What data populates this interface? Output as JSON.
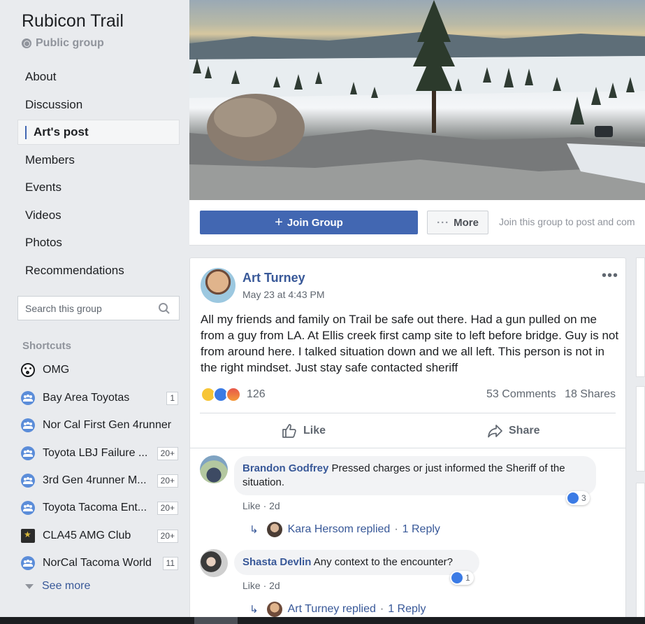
{
  "group": {
    "title": "Rubicon Trail",
    "privacy": "Public group"
  },
  "nav": {
    "items": [
      {
        "label": "About"
      },
      {
        "label": "Discussion"
      },
      {
        "label": "Art's post"
      },
      {
        "label": "Members"
      },
      {
        "label": "Events"
      },
      {
        "label": "Videos"
      },
      {
        "label": "Photos"
      },
      {
        "label": "Recommendations"
      }
    ],
    "active_index": 2
  },
  "search": {
    "placeholder": "Search this group"
  },
  "shortcuts": {
    "title": "Shortcuts",
    "items": [
      {
        "label": "OMG",
        "badge": "",
        "icon": "omg-icon"
      },
      {
        "label": "Bay Area Toyotas",
        "badge": "1",
        "icon": "group-icon"
      },
      {
        "label": "Nor Cal First Gen 4runner",
        "badge": "",
        "icon": "group-icon"
      },
      {
        "label": "Toyota LBJ Failure ...",
        "badge": "20+",
        "icon": "group-icon"
      },
      {
        "label": "3rd Gen 4runner M...",
        "badge": "20+",
        "icon": "group-icon"
      },
      {
        "label": "Toyota Tacoma Ent...",
        "badge": "20+",
        "icon": "group-icon"
      },
      {
        "label": "CLA45 AMG Club",
        "badge": "20+",
        "icon": "cla-icon"
      },
      {
        "label": "NorCal Tacoma World",
        "badge": "11",
        "icon": "group-icon"
      }
    ],
    "see_more": "See more"
  },
  "join_bar": {
    "join_label": "Join Group",
    "more_label": "More",
    "hint": "Join this group to post and com"
  },
  "post": {
    "author": "Art Turney",
    "timestamp": "May 23 at 4:43 PM",
    "text": "All my friends and family on Trail be safe out there. Had a gun pulled on me from a guy from LA. At Ellis creek first camp site to left before bridge. Guy is not from around here. I talked situation down and we all left. This person is not in the right mindset. Just stay safe contacted sheriff",
    "reaction_count": "126",
    "comments_count": "53 Comments",
    "shares_count": "18 Shares",
    "like_label": "Like",
    "share_label": "Share"
  },
  "comments": [
    {
      "name": "Brandon Godfrey",
      "text": "Pressed charges or just informed the Sheriff of the situation.",
      "like_label": "Like",
      "age": "2d",
      "reactions": "3",
      "reply_author": "Kara Hersom replied",
      "reply_count": "1 Reply"
    },
    {
      "name": "Shasta Devlin",
      "text": "Any context to the encounter?",
      "like_label": "Like",
      "age": "2d",
      "reactions": "1",
      "reply_author": "Art Turney replied",
      "reply_count": "1 Reply"
    }
  ],
  "colors": {
    "accent": "#4267b2",
    "link": "#385898",
    "background": "#e9ebee"
  }
}
